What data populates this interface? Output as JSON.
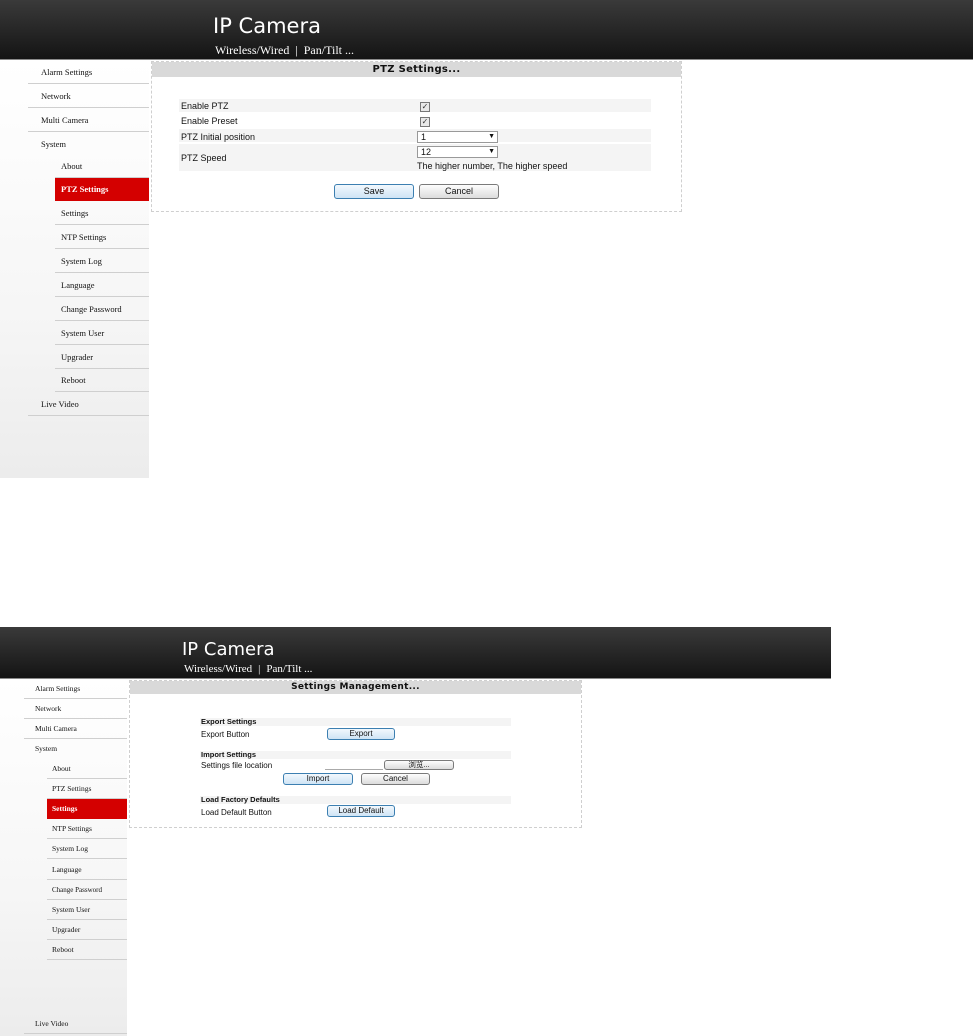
{
  "brand": {
    "title": "IP Camera",
    "crumb_1": "Wireless/Wired",
    "crumb_sep": "|",
    "crumb_2": "Pan/Tilt ..."
  },
  "nav": {
    "alarm": "Alarm Settings",
    "network": "Network",
    "multi": "Multi Camera",
    "system": "System",
    "about": "About",
    "ptz": "PTZ Settings",
    "settings": "Settings",
    "ntp": "NTP Settings",
    "syslog": "System Log",
    "language": "Language",
    "password": "Change Password",
    "sysuser": "System User",
    "upgrader": "Upgrader",
    "reboot": "Reboot",
    "live": "Live Video"
  },
  "top": {
    "panel_title": "PTZ Settings...",
    "enable_ptz_label": "Enable PTZ",
    "enable_ptz_checked": true,
    "enable_preset_label": "Enable Preset",
    "enable_preset_checked": true,
    "initial_position_label": "PTZ Initial position",
    "initial_position_value": "1",
    "speed_label": "PTZ Speed",
    "speed_value": "12",
    "speed_hint": "The higher number, The higher speed",
    "save_label": "Save",
    "cancel_label": "Cancel",
    "checkmark": "✓",
    "arrow": "▼"
  },
  "bottom": {
    "panel_title": "Settings Management...",
    "export_heading": "Export Settings",
    "export_label": "Export Button",
    "export_button": "Export",
    "import_heading": "Import Settings",
    "file_label": "Settings file location",
    "browse_button": "浏览...",
    "import_button": "Import",
    "cancel_button": "Cancel",
    "defaults_heading": "Load Factory Defaults",
    "defaults_label": "Load Default Button",
    "defaults_button": "Load Default"
  }
}
